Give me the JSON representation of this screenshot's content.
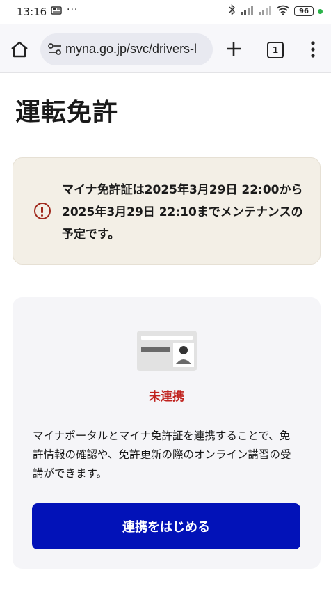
{
  "statusbar": {
    "time": "13:16",
    "notification_icon": "news-icon",
    "overflow": "···",
    "battery": "96"
  },
  "browser": {
    "url": "myna.go.jp/svc/drivers-l",
    "tab_count": "1"
  },
  "page": {
    "title": "運転免許"
  },
  "notice": {
    "text": "マイナ免許証は2025年3月29日 22:00から2025年3月29日 22:10までメンテナンスの予定です。"
  },
  "card": {
    "status": "未連携",
    "description": "マイナポータルとマイナ免許証を連携することで、免許情報の確認や、免許更新の際のオンライン講習の受講ができます。",
    "button_label": "連携をはじめる"
  },
  "colors": {
    "notice_bg": "#f3efe6",
    "warning": "#a0291c",
    "status_red": "#c0221e",
    "primary_button": "#0212b8"
  }
}
